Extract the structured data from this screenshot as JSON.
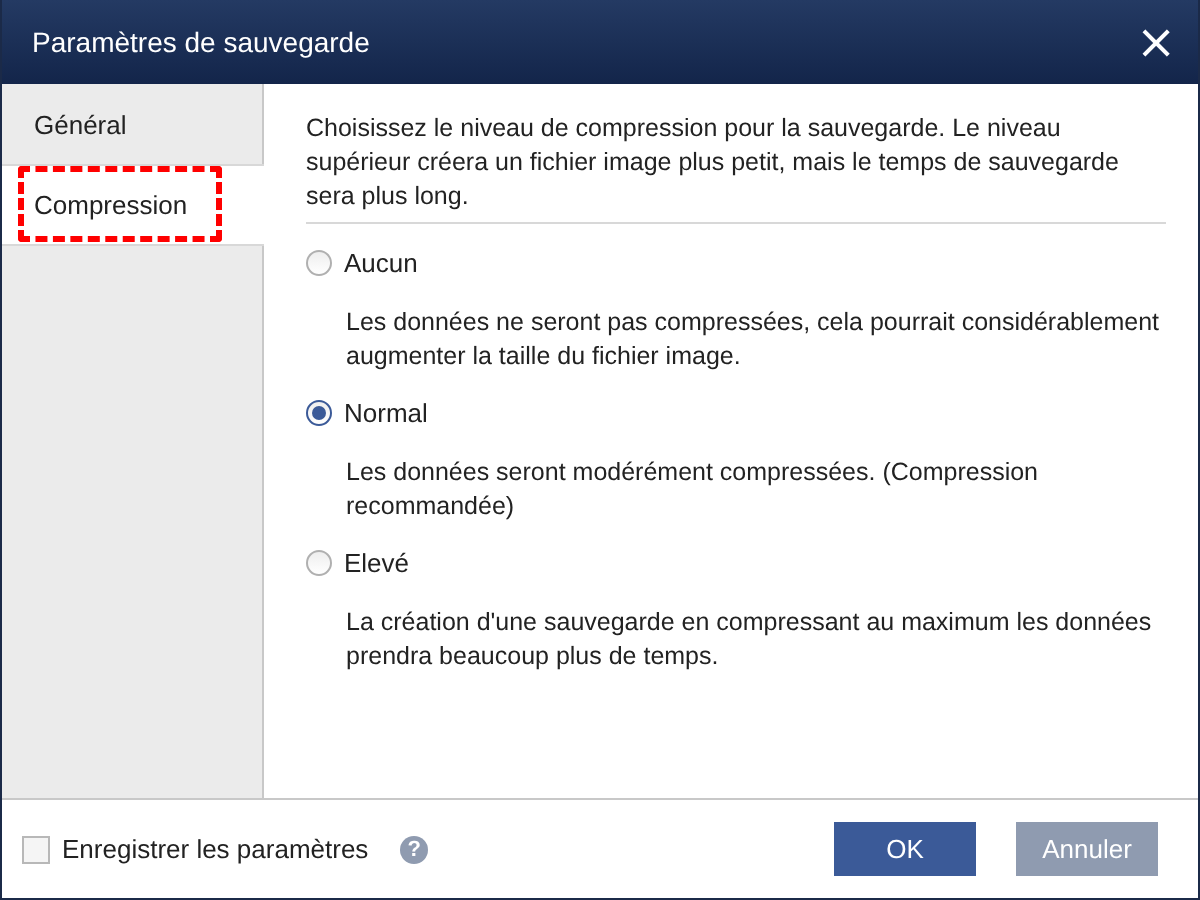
{
  "window": {
    "title": "Paramètres de sauvegarde",
    "close": "×"
  },
  "tabs": [
    {
      "label": "Général",
      "selected": false,
      "highlighted": false
    },
    {
      "label": "Compression",
      "selected": true,
      "highlighted": true
    }
  ],
  "intro": "Choisissez le niveau de compression pour la sauvegarde. Le niveau supérieur créera un fichier image plus petit, mais le temps de sauvegarde sera plus long.",
  "options": [
    {
      "label": "Aucun",
      "selected": false,
      "description": "Les données ne seront pas compressées, cela pourrait considérablement augmenter la taille du fichier image."
    },
    {
      "label": "Normal",
      "selected": true,
      "description": "Les données seront modérément compressées. (Compression recommandée)"
    },
    {
      "label": "Elevé",
      "selected": false,
      "description": "La création d'une sauvegarde en compressant au maximum les données prendra beaucoup plus de temps."
    }
  ],
  "footer": {
    "checkbox": {
      "label": "Enregistrer les paramètres",
      "checked": false
    },
    "help": "?",
    "buttons": [
      {
        "label": "OK",
        "kind": "primary"
      },
      {
        "label": "Annuler",
        "kind": "secondary"
      }
    ]
  }
}
